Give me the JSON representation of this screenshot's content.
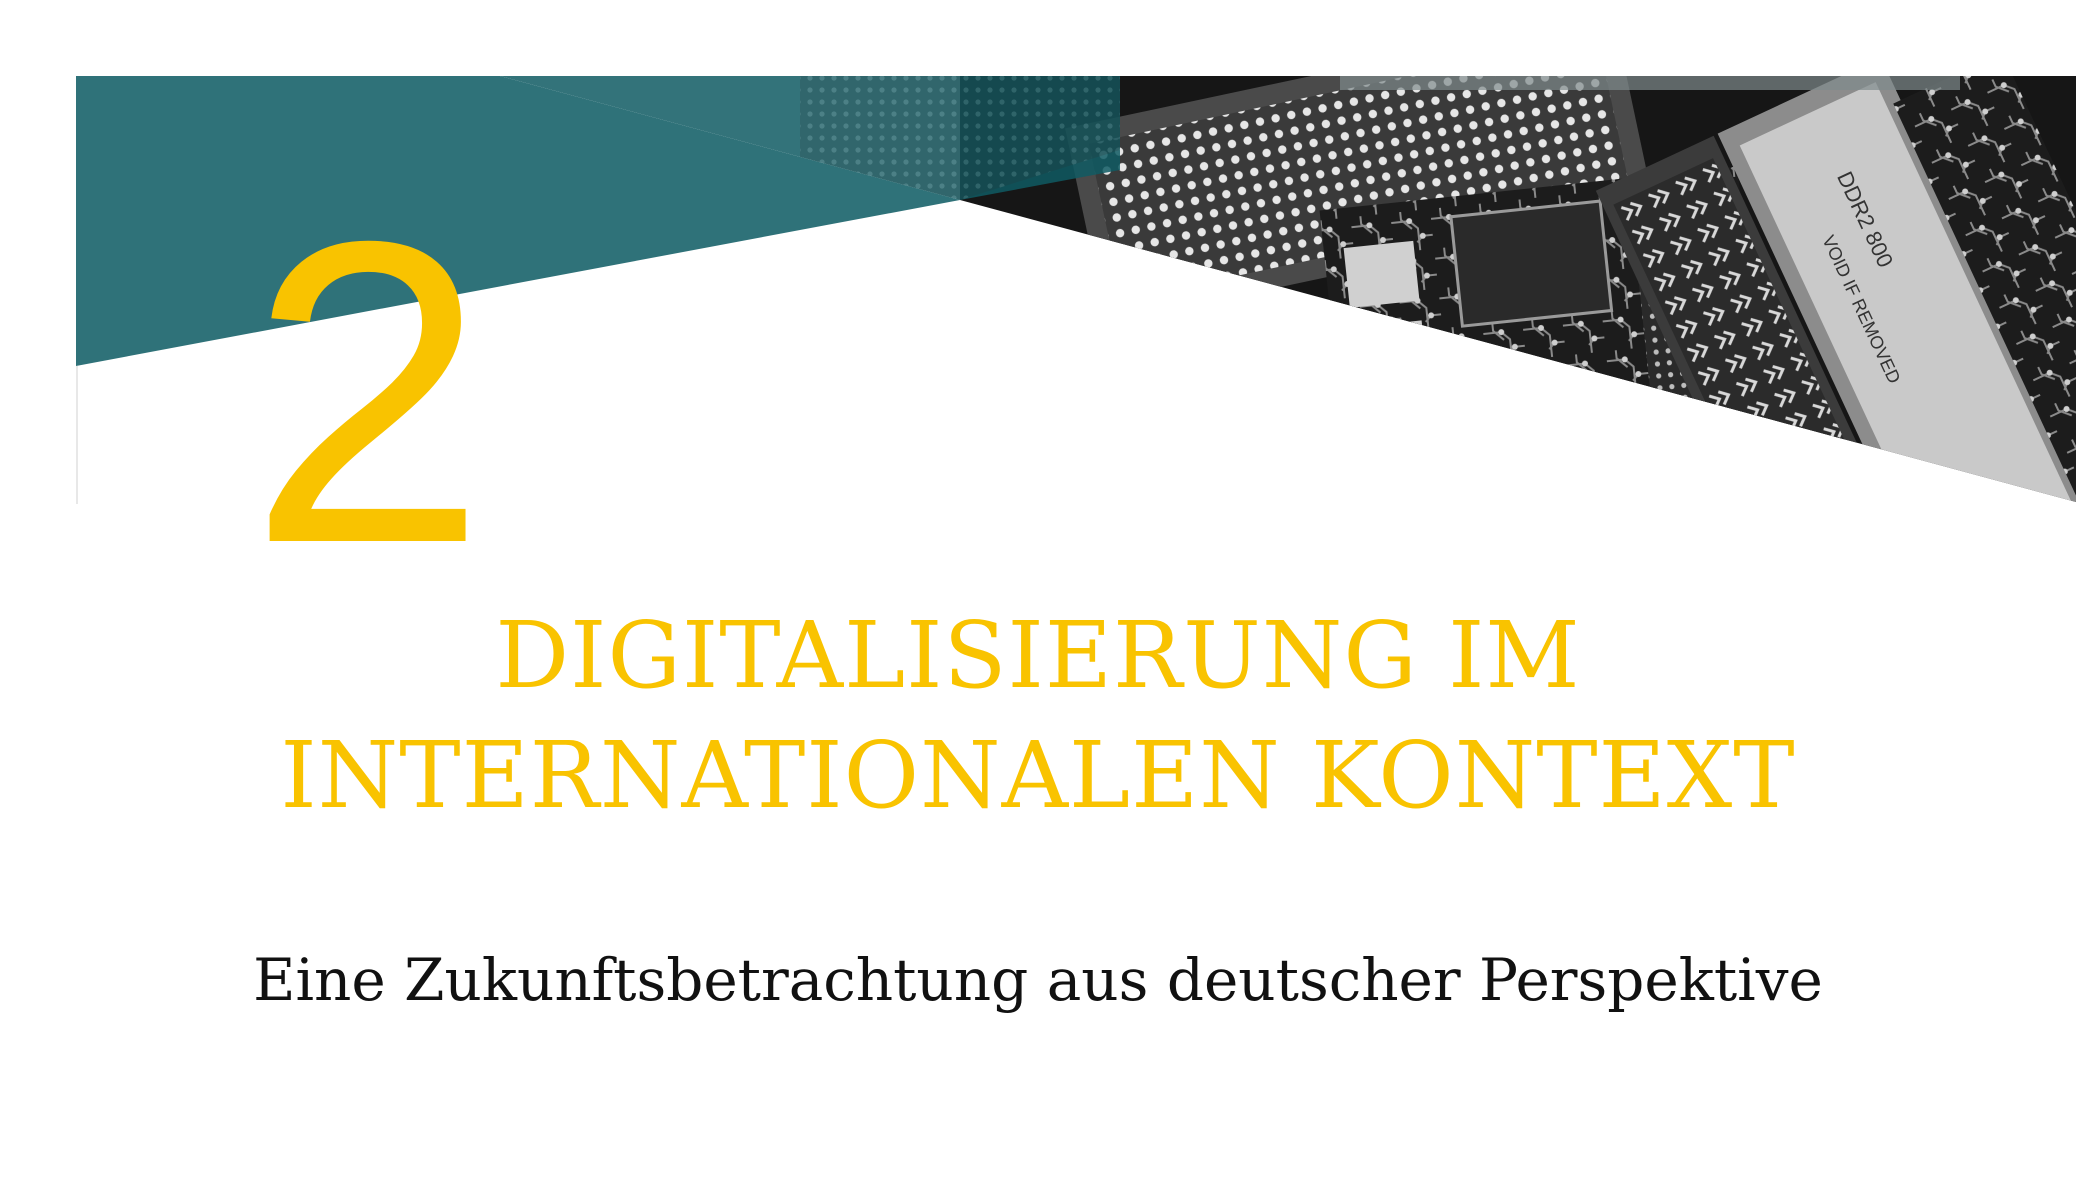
{
  "chapter": {
    "number": "2",
    "title_line_1": "DIGITALISIERUNG IM",
    "title_line_2": "INTERNATIONALEN KONTEXT",
    "subtitle": "Eine Zukunftsbetrachtung aus deutscher Perspektive"
  },
  "banner": {
    "image_subject": "circuit-board-memory-modules-photo",
    "board_text": [
      "DDR2 800",
      "VOID IF REMOVED"
    ]
  },
  "colors": {
    "accent_yellow": "#f9c300",
    "teal": "#2f7279",
    "dark_teal": "#0f5a63",
    "text": "#111111",
    "background": "#ffffff"
  }
}
